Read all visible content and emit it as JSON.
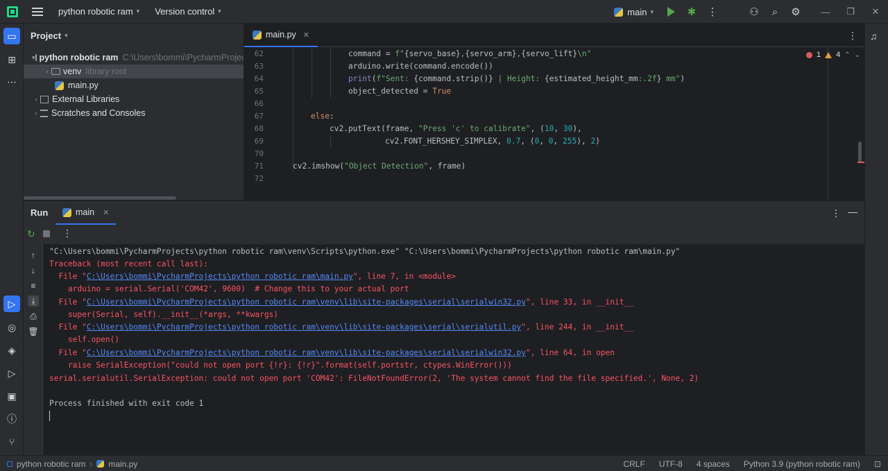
{
  "titlebar": {
    "project_name": "python robotic ram",
    "version_control": "Version control",
    "run_config": "main"
  },
  "project_panel": {
    "title": "Project",
    "tree": [
      {
        "label": "python robotic ram",
        "hint": "C:\\Users\\bommi\\PycharmProjects\\python robotic ram"
      },
      {
        "label": "venv",
        "hint": "library root"
      },
      {
        "label": "main.py",
        "hint": ""
      },
      {
        "label": "External Libraries",
        "hint": ""
      },
      {
        "label": "Scratches and Consoles",
        "hint": ""
      }
    ]
  },
  "editor": {
    "tab": "main.py",
    "errors": "1",
    "warnings": "4",
    "line_numbers": [
      "62",
      "63",
      "64",
      "65",
      "66",
      "67",
      "68",
      "69",
      "70",
      "71",
      "72"
    ]
  },
  "run_panel": {
    "title": "Run",
    "tab": "main",
    "console": {
      "cmd": "\"C:\\Users\\bommi\\PycharmProjects\\python robotic ram\\venv\\Scripts\\python.exe\" \"C:\\Users\\bommi\\PycharmProjects\\python robotic ram\\main.py\"",
      "traceback_head": "Traceback (most recent call last):",
      "frames": [
        {
          "prefix": "  File \"",
          "path": "C:\\Users\\bommi\\PycharmProjects\\python robotic ram\\main.py",
          "suffix": "\", line 7, in <module>",
          "code": "    arduino = serial.Serial('COM42', 9600)  # Change this to your actual port"
        },
        {
          "prefix": "  File \"",
          "path": "C:\\Users\\bommi\\PycharmProjects\\python robotic ram\\venv\\lib\\site-packages\\serial\\serialwin32.py",
          "suffix": "\", line 33, in __init__",
          "code": "    super(Serial, self).__init__(*args, **kwargs)"
        },
        {
          "prefix": "  File \"",
          "path": "C:\\Users\\bommi\\PycharmProjects\\python robotic ram\\venv\\lib\\site-packages\\serial\\serialutil.py",
          "suffix": "\", line 244, in __init__",
          "code": "    self.open()"
        },
        {
          "prefix": "  File \"",
          "path": "C:\\Users\\bommi\\PycharmProjects\\python robotic ram\\venv\\lib\\site-packages\\serial\\serialwin32.py",
          "suffix": "\", line 64, in open",
          "code": "    raise SerialException(\"could not open port {!r}: {!r}\".format(self.portstr, ctypes.WinError()))"
        }
      ],
      "exception": "serial.serialutil.SerialException: could not open port 'COM42': FileNotFoundError(2, 'The system cannot find the file specified.', None, 2)",
      "exit": "Process finished with exit code 1"
    }
  },
  "statusbar": {
    "project": "python robotic ram",
    "file": "main.py",
    "line_sep": "CRLF",
    "encoding": "UTF-8",
    "indent": "4 spaces",
    "interpreter": "Python 3.9 (python robotic ram)"
  },
  "colors": {
    "accent": "#3574f0",
    "error": "#f75464",
    "link": "#548af7",
    "run_green": "#57a64a"
  }
}
